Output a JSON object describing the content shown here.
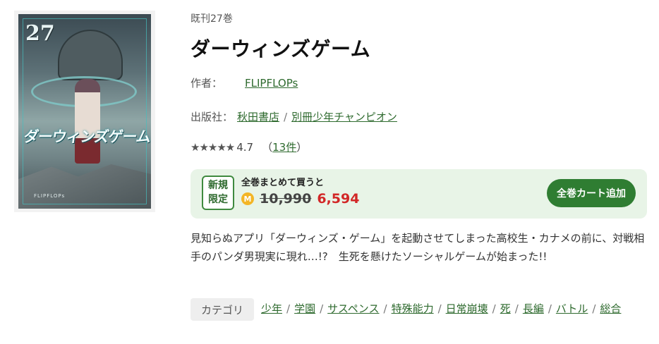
{
  "cover": {
    "volume_number": "27",
    "title_art": "ダーウィンズゲーム",
    "footer_text": "FLIPFLOPs"
  },
  "book": {
    "volumes_label": "既刊27巻",
    "title": "ダーウィンズゲーム"
  },
  "author": {
    "key": "作者：",
    "name": "FLIPFLOPs"
  },
  "publisher": {
    "key": "出版社：",
    "publisher": "秋田書店",
    "magazine": "別冊少年チャンピオン",
    "separator": "/"
  },
  "rating": {
    "stars": "★★★★★",
    "score": "4.7",
    "open_paren": "（",
    "count": "13件",
    "close_paren": "）",
    "value": 4.7
  },
  "deal": {
    "badge_line1": "新規",
    "badge_line2": "限定",
    "label": "全巻まとめて買うと",
    "coin_symbol": "M",
    "original_price": "10,990",
    "sale_price": "6,594",
    "button_label": "全巻カート追加"
  },
  "description": "見知らぬアプリ「ダーウィンズ・ゲーム」を起動させてしまった高校生・カナメの前に、対戦相手のパンダ男現実に現れ…!?　生死を懸けたソーシャルゲームが始まった!!",
  "categories": {
    "label": "カテゴリ",
    "items": [
      "少年",
      "学園",
      "サスペンス",
      "特殊能力",
      "日常崩壊",
      "死",
      "長編",
      "バトル",
      "総合"
    ],
    "separator": "/"
  },
  "colors": {
    "link_green": "#2e6a2e",
    "button_green": "#2f7d32",
    "deal_bg": "#e8f4e7",
    "sale_red": "#d22727",
    "coin_gold": "#f3b526"
  }
}
